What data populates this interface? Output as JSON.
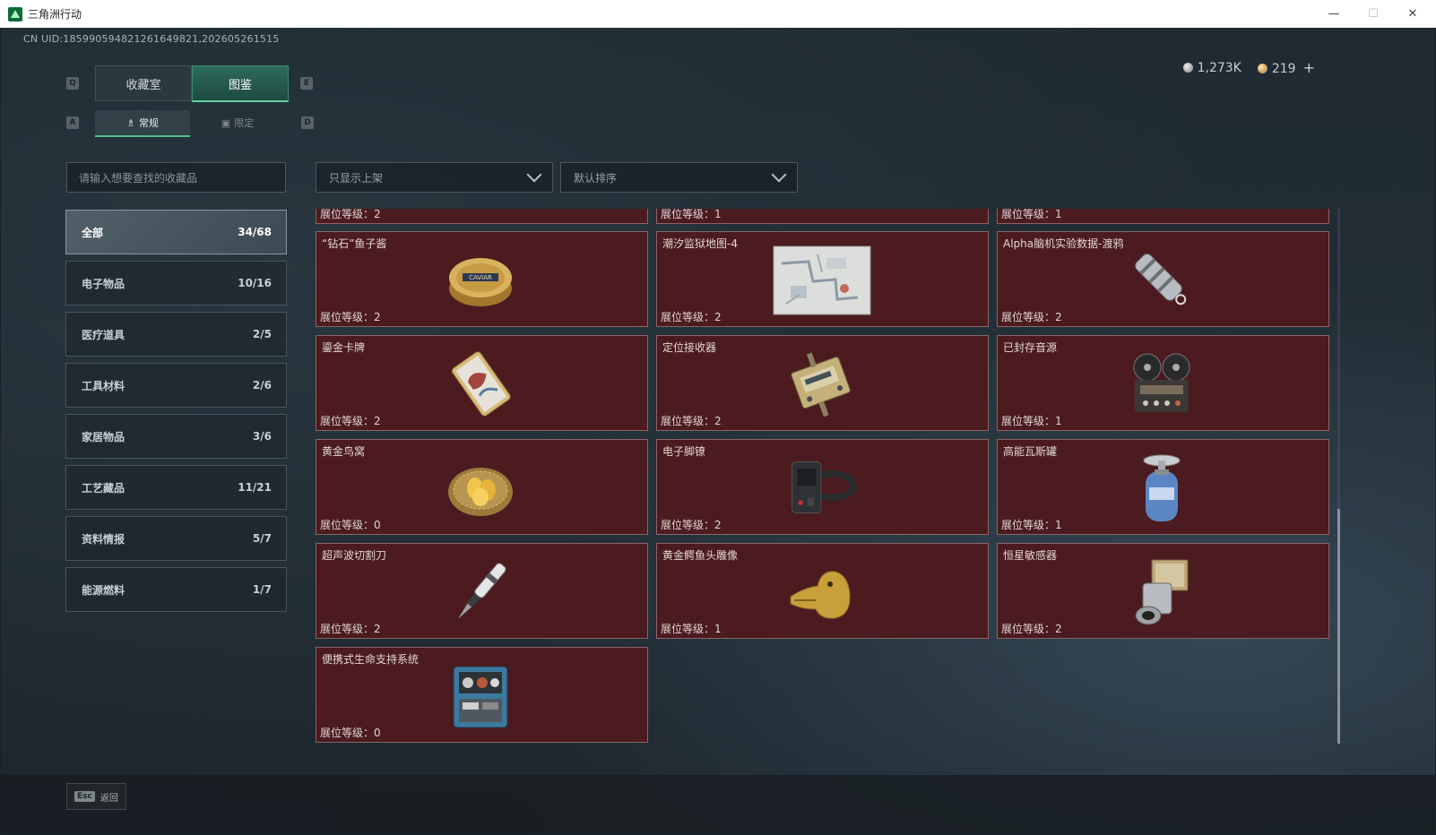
{
  "window": {
    "title": "三角洲行动"
  },
  "uid": "CN UID:18599059482126164982​1,202605261515",
  "currency": {
    "silver": "1,273K",
    "gold": "219",
    "plus": "+"
  },
  "keys": {
    "prev_tab": "Q",
    "next_tab": "E",
    "prev_sub": "A",
    "next_sub": "D"
  },
  "tabs": [
    {
      "label": "收藏室"
    },
    {
      "label": "图鉴"
    }
  ],
  "subtabs": [
    {
      "label": "常规"
    },
    {
      "label": "限定"
    }
  ],
  "search": {
    "placeholder": "请输入想要查找的收藏品"
  },
  "filter": {
    "value": "只显示上架"
  },
  "sort": {
    "value": "默认排序"
  },
  "categories": [
    {
      "label": "全部",
      "count": "34/68"
    },
    {
      "label": "电子物品",
      "count": "10/16"
    },
    {
      "label": "医疗道具",
      "count": "2/5"
    },
    {
      "label": "工具材料",
      "count": "2/6"
    },
    {
      "label": "家居物品",
      "count": "3/6"
    },
    {
      "label": "工艺藏品",
      "count": "11/21"
    },
    {
      "label": "资料情报",
      "count": "5/7"
    },
    {
      "label": "能源燃料",
      "count": "1/7"
    }
  ],
  "partial_row": [
    "展位等级：2",
    "展位等级：1",
    "展位等级：1"
  ],
  "items": [
    {
      "name": "“钻石”鱼子酱",
      "level": "展位等级：2",
      "icon": "caviar-tin-icon"
    },
    {
      "name": "潮汐监狱地图-4",
      "level": "展位等级：2",
      "icon": "prison-map-icon"
    },
    {
      "name": "Alpha脑机实验数据-渡鸦",
      "level": "展位等级：2",
      "icon": "data-capsule-icon"
    },
    {
      "name": "鎏金卡牌",
      "level": "展位等级：2",
      "icon": "gilded-card-icon"
    },
    {
      "name": "定位接收器",
      "level": "展位等级：2",
      "icon": "receiver-device-icon"
    },
    {
      "name": "已封存音源",
      "level": "展位等级：1",
      "icon": "reel-recorder-icon"
    },
    {
      "name": "黄金鸟窝",
      "level": "展位等级：0",
      "icon": "golden-nest-icon"
    },
    {
      "name": "电子脚镣",
      "level": "展位等级：2",
      "icon": "ankle-monitor-icon"
    },
    {
      "name": "高能瓦斯罐",
      "level": "展位等级：1",
      "icon": "gas-canister-icon"
    },
    {
      "name": "超声波切割刀",
      "level": "展位等级：2",
      "icon": "ultrasonic-knife-icon"
    },
    {
      "name": "黄金鳄鱼头雕像",
      "level": "展位等级：1",
      "icon": "gold-crocodile-icon"
    },
    {
      "name": "恒星敏感器",
      "level": "展位等级：2",
      "icon": "star-sensor-icon"
    },
    {
      "name": "便携式生命支持系统",
      "level": "展位等级：0",
      "icon": "life-support-icon"
    }
  ],
  "back": {
    "key": "Esc",
    "label": "返回"
  }
}
